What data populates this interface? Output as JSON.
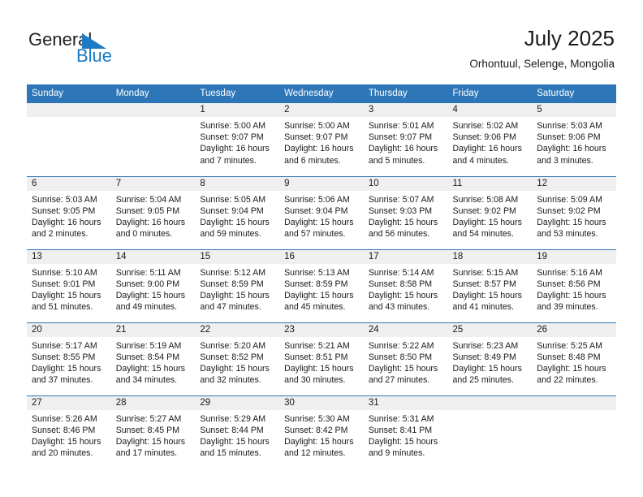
{
  "brand": {
    "name_part1": "General",
    "name_part2": "Blue",
    "flag_color": "#1c7bc4"
  },
  "header": {
    "title": "July 2025",
    "subtitle": "Orhontuul, Selenge, Mongolia"
  },
  "theme": {
    "header_blue": "#2d76b8",
    "daynum_band": "#efefef",
    "text": "#1a1a1a"
  },
  "weekdays": [
    "Sunday",
    "Monday",
    "Tuesday",
    "Wednesday",
    "Thursday",
    "Friday",
    "Saturday"
  ],
  "weeks": [
    [
      {
        "day": "",
        "sunrise": "",
        "sunset": "",
        "daylight1": "",
        "daylight2": ""
      },
      {
        "day": "",
        "sunrise": "",
        "sunset": "",
        "daylight1": "",
        "daylight2": ""
      },
      {
        "day": "1",
        "sunrise": "Sunrise: 5:00 AM",
        "sunset": "Sunset: 9:07 PM",
        "daylight1": "Daylight: 16 hours",
        "daylight2": "and 7 minutes."
      },
      {
        "day": "2",
        "sunrise": "Sunrise: 5:00 AM",
        "sunset": "Sunset: 9:07 PM",
        "daylight1": "Daylight: 16 hours",
        "daylight2": "and 6 minutes."
      },
      {
        "day": "3",
        "sunrise": "Sunrise: 5:01 AM",
        "sunset": "Sunset: 9:07 PM",
        "daylight1": "Daylight: 16 hours",
        "daylight2": "and 5 minutes."
      },
      {
        "day": "4",
        "sunrise": "Sunrise: 5:02 AM",
        "sunset": "Sunset: 9:06 PM",
        "daylight1": "Daylight: 16 hours",
        "daylight2": "and 4 minutes."
      },
      {
        "day": "5",
        "sunrise": "Sunrise: 5:03 AM",
        "sunset": "Sunset: 9:06 PM",
        "daylight1": "Daylight: 16 hours",
        "daylight2": "and 3 minutes."
      }
    ],
    [
      {
        "day": "6",
        "sunrise": "Sunrise: 5:03 AM",
        "sunset": "Sunset: 9:05 PM",
        "daylight1": "Daylight: 16 hours",
        "daylight2": "and 2 minutes."
      },
      {
        "day": "7",
        "sunrise": "Sunrise: 5:04 AM",
        "sunset": "Sunset: 9:05 PM",
        "daylight1": "Daylight: 16 hours",
        "daylight2": "and 0 minutes."
      },
      {
        "day": "8",
        "sunrise": "Sunrise: 5:05 AM",
        "sunset": "Sunset: 9:04 PM",
        "daylight1": "Daylight: 15 hours",
        "daylight2": "and 59 minutes."
      },
      {
        "day": "9",
        "sunrise": "Sunrise: 5:06 AM",
        "sunset": "Sunset: 9:04 PM",
        "daylight1": "Daylight: 15 hours",
        "daylight2": "and 57 minutes."
      },
      {
        "day": "10",
        "sunrise": "Sunrise: 5:07 AM",
        "sunset": "Sunset: 9:03 PM",
        "daylight1": "Daylight: 15 hours",
        "daylight2": "and 56 minutes."
      },
      {
        "day": "11",
        "sunrise": "Sunrise: 5:08 AM",
        "sunset": "Sunset: 9:02 PM",
        "daylight1": "Daylight: 15 hours",
        "daylight2": "and 54 minutes."
      },
      {
        "day": "12",
        "sunrise": "Sunrise: 5:09 AM",
        "sunset": "Sunset: 9:02 PM",
        "daylight1": "Daylight: 15 hours",
        "daylight2": "and 53 minutes."
      }
    ],
    [
      {
        "day": "13",
        "sunrise": "Sunrise: 5:10 AM",
        "sunset": "Sunset: 9:01 PM",
        "daylight1": "Daylight: 15 hours",
        "daylight2": "and 51 minutes."
      },
      {
        "day": "14",
        "sunrise": "Sunrise: 5:11 AM",
        "sunset": "Sunset: 9:00 PM",
        "daylight1": "Daylight: 15 hours",
        "daylight2": "and 49 minutes."
      },
      {
        "day": "15",
        "sunrise": "Sunrise: 5:12 AM",
        "sunset": "Sunset: 8:59 PM",
        "daylight1": "Daylight: 15 hours",
        "daylight2": "and 47 minutes."
      },
      {
        "day": "16",
        "sunrise": "Sunrise: 5:13 AM",
        "sunset": "Sunset: 8:59 PM",
        "daylight1": "Daylight: 15 hours",
        "daylight2": "and 45 minutes."
      },
      {
        "day": "17",
        "sunrise": "Sunrise: 5:14 AM",
        "sunset": "Sunset: 8:58 PM",
        "daylight1": "Daylight: 15 hours",
        "daylight2": "and 43 minutes."
      },
      {
        "day": "18",
        "sunrise": "Sunrise: 5:15 AM",
        "sunset": "Sunset: 8:57 PM",
        "daylight1": "Daylight: 15 hours",
        "daylight2": "and 41 minutes."
      },
      {
        "day": "19",
        "sunrise": "Sunrise: 5:16 AM",
        "sunset": "Sunset: 8:56 PM",
        "daylight1": "Daylight: 15 hours",
        "daylight2": "and 39 minutes."
      }
    ],
    [
      {
        "day": "20",
        "sunrise": "Sunrise: 5:17 AM",
        "sunset": "Sunset: 8:55 PM",
        "daylight1": "Daylight: 15 hours",
        "daylight2": "and 37 minutes."
      },
      {
        "day": "21",
        "sunrise": "Sunrise: 5:19 AM",
        "sunset": "Sunset: 8:54 PM",
        "daylight1": "Daylight: 15 hours",
        "daylight2": "and 34 minutes."
      },
      {
        "day": "22",
        "sunrise": "Sunrise: 5:20 AM",
        "sunset": "Sunset: 8:52 PM",
        "daylight1": "Daylight: 15 hours",
        "daylight2": "and 32 minutes."
      },
      {
        "day": "23",
        "sunrise": "Sunrise: 5:21 AM",
        "sunset": "Sunset: 8:51 PM",
        "daylight1": "Daylight: 15 hours",
        "daylight2": "and 30 minutes."
      },
      {
        "day": "24",
        "sunrise": "Sunrise: 5:22 AM",
        "sunset": "Sunset: 8:50 PM",
        "daylight1": "Daylight: 15 hours",
        "daylight2": "and 27 minutes."
      },
      {
        "day": "25",
        "sunrise": "Sunrise: 5:23 AM",
        "sunset": "Sunset: 8:49 PM",
        "daylight1": "Daylight: 15 hours",
        "daylight2": "and 25 minutes."
      },
      {
        "day": "26",
        "sunrise": "Sunrise: 5:25 AM",
        "sunset": "Sunset: 8:48 PM",
        "daylight1": "Daylight: 15 hours",
        "daylight2": "and 22 minutes."
      }
    ],
    [
      {
        "day": "27",
        "sunrise": "Sunrise: 5:26 AM",
        "sunset": "Sunset: 8:46 PM",
        "daylight1": "Daylight: 15 hours",
        "daylight2": "and 20 minutes."
      },
      {
        "day": "28",
        "sunrise": "Sunrise: 5:27 AM",
        "sunset": "Sunset: 8:45 PM",
        "daylight1": "Daylight: 15 hours",
        "daylight2": "and 17 minutes."
      },
      {
        "day": "29",
        "sunrise": "Sunrise: 5:29 AM",
        "sunset": "Sunset: 8:44 PM",
        "daylight1": "Daylight: 15 hours",
        "daylight2": "and 15 minutes."
      },
      {
        "day": "30",
        "sunrise": "Sunrise: 5:30 AM",
        "sunset": "Sunset: 8:42 PM",
        "daylight1": "Daylight: 15 hours",
        "daylight2": "and 12 minutes."
      },
      {
        "day": "31",
        "sunrise": "Sunrise: 5:31 AM",
        "sunset": "Sunset: 8:41 PM",
        "daylight1": "Daylight: 15 hours",
        "daylight2": "and 9 minutes."
      },
      {
        "day": "",
        "sunrise": "",
        "sunset": "",
        "daylight1": "",
        "daylight2": ""
      },
      {
        "day": "",
        "sunrise": "",
        "sunset": "",
        "daylight1": "",
        "daylight2": ""
      }
    ]
  ]
}
